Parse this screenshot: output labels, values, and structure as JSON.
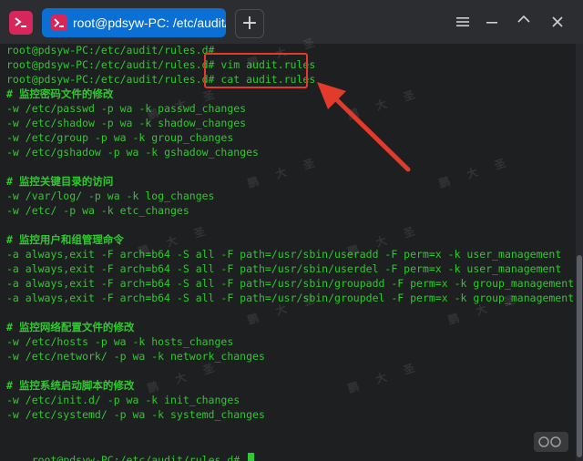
{
  "window": {
    "tab_title": "root@pdsyw-PC: /etc/audit/rules.d",
    "add_tab_label": "+"
  },
  "terminal": {
    "lines": [
      {
        "text": "root@pdsyw-PC:/etc/audit/rules.d#",
        "type": "prompt"
      },
      {
        "text": "root@pdsyw-PC:/etc/audit/rules.d# vim audit.rules",
        "type": "prompt"
      },
      {
        "text": "root@pdsyw-PC:/etc/audit/rules.d# cat audit.rules",
        "type": "prompt"
      },
      {
        "text": "# 监控密码文件的修改",
        "type": "comment"
      },
      {
        "text": "-w /etc/passwd -p wa -k passwd_changes",
        "type": "rule"
      },
      {
        "text": "-w /etc/shadow -p wa -k shadow_changes",
        "type": "rule"
      },
      {
        "text": "-w /etc/group -p wa -k group_changes",
        "type": "rule"
      },
      {
        "text": "-w /etc/gshadow -p wa -k gshadow_changes",
        "type": "rule"
      },
      {
        "text": "",
        "type": "blank"
      },
      {
        "text": "# 监控关键目录的访问",
        "type": "comment"
      },
      {
        "text": "-w /var/log/ -p wa -k log_changes",
        "type": "rule"
      },
      {
        "text": "-w /etc/ -p wa -k etc_changes",
        "type": "rule"
      },
      {
        "text": "",
        "type": "blank"
      },
      {
        "text": "# 监控用户和组管理命令",
        "type": "comment"
      },
      {
        "text": "-a always,exit -F arch=b64 -S all -F path=/usr/sbin/useradd -F perm=x -k user_management",
        "type": "rule"
      },
      {
        "text": "-a always,exit -F arch=b64 -S all -F path=/usr/sbin/userdel -F perm=x -k user_management",
        "type": "rule"
      },
      {
        "text": "-a always,exit -F arch=b64 -S all -F path=/usr/sbin/groupadd -F perm=x -k group_management",
        "type": "rule"
      },
      {
        "text": "-a always,exit -F arch=b64 -S all -F path=/usr/sbin/groupdel -F perm=x -k group_management",
        "type": "rule"
      },
      {
        "text": "",
        "type": "blank"
      },
      {
        "text": "# 监控网络配置文件的修改",
        "type": "comment"
      },
      {
        "text": "-w /etc/hosts -p wa -k hosts_changes",
        "type": "rule"
      },
      {
        "text": "-w /etc/network/ -p wa -k network_changes",
        "type": "rule"
      },
      {
        "text": "",
        "type": "blank"
      },
      {
        "text": "# 监控系统启动脚本的修改",
        "type": "comment"
      },
      {
        "text": "-w /etc/init.d/ -p wa -k init_changes",
        "type": "rule"
      },
      {
        "text": "-w /etc/systemd/ -p wa -k systemd_changes",
        "type": "rule"
      },
      {
        "text": "",
        "type": "blank"
      },
      {
        "text": "root@pdsyw-PC:/etc/audit/rules.d# ",
        "type": "prompt-active"
      }
    ]
  },
  "watermark": {
    "text": "鹏 大 圣"
  },
  "colors": {
    "terminal_text": "#2ec92e",
    "tab_active": "#0b6fd3",
    "app_icon": "#d7265a",
    "annotation": "#e23a2b"
  },
  "icons": {
    "app": "terminal-app-icon",
    "tab": "terminal-tab-icon",
    "add": "plus-icon",
    "menu": "hamburger-menu-icon",
    "minimize": "minimize-icon",
    "maximize": "maximize-icon",
    "close": "close-icon",
    "annotation": "arrow-icon"
  }
}
